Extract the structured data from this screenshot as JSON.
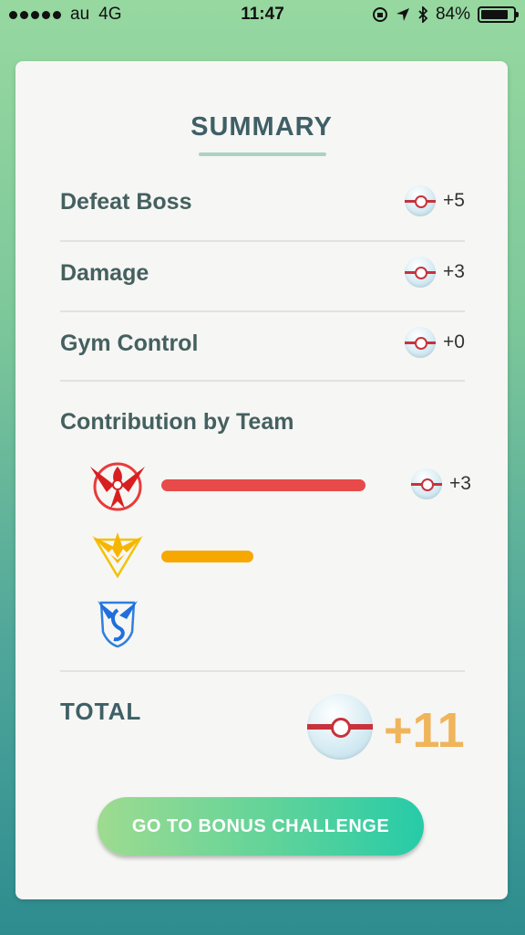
{
  "status_bar": {
    "carrier": "au",
    "network": "4G",
    "time": "11:47",
    "battery": "84%",
    "battery_level": 0.84
  },
  "summary": {
    "title": "SUMMARY",
    "rows": [
      {
        "label": "Defeat Boss",
        "reward": "+5"
      },
      {
        "label": "Damage",
        "reward": "+3"
      },
      {
        "label": "Gym Control",
        "reward": "+0"
      }
    ]
  },
  "contribution": {
    "title": "Contribution by Team",
    "teams": [
      {
        "name": "valor",
        "color": "#e84a4a",
        "bar_fraction": 1.0,
        "reward": "+3"
      },
      {
        "name": "instinct",
        "color": "#f7a800",
        "bar_fraction": 0.45,
        "reward": ""
      },
      {
        "name": "mystic",
        "color": "#2f7fe0",
        "bar_fraction": 0,
        "reward": ""
      }
    ]
  },
  "total": {
    "label": "TOTAL",
    "value": "+11"
  },
  "button": {
    "label": "GO TO BONUS CHALLENGE"
  },
  "icons": {
    "reward": "premier-ball-icon"
  }
}
